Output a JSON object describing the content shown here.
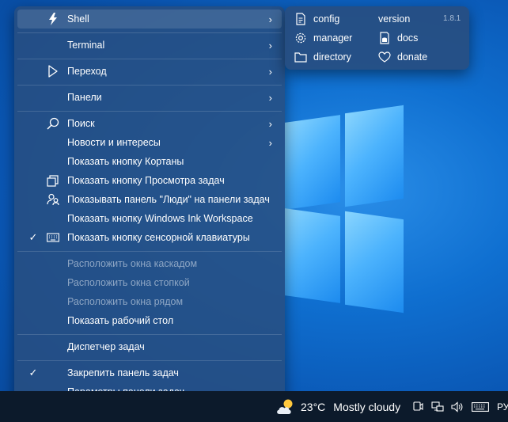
{
  "menu": {
    "items": [
      {
        "label": "Shell",
        "icon": "shell-icon",
        "arrow": true,
        "check": false,
        "disabled": false
      },
      {
        "label": "Terminal",
        "icon": "",
        "arrow": true,
        "check": false,
        "disabled": false
      },
      {
        "label": "Переход",
        "icon": "cursor-icon",
        "arrow": true,
        "check": false,
        "disabled": false
      },
      {
        "label": "Панели",
        "icon": "",
        "arrow": true,
        "check": false,
        "disabled": false
      },
      {
        "label": "Поиск",
        "icon": "search-icon",
        "arrow": true,
        "check": false,
        "disabled": false
      },
      {
        "label": "Новости и интересы",
        "icon": "",
        "arrow": true,
        "check": false,
        "disabled": false
      },
      {
        "label": "Показать кнопку Кортаны",
        "icon": "",
        "arrow": false,
        "check": false,
        "disabled": false
      },
      {
        "label": "Показать кнопку Просмотра задач",
        "icon": "task-view-icon",
        "arrow": false,
        "check": false,
        "disabled": false
      },
      {
        "label": "Показывать панель \"Люди\" на панели задач",
        "icon": "people-icon",
        "arrow": false,
        "check": false,
        "disabled": false
      },
      {
        "label": "Показать кнопку Windows Ink Workspace",
        "icon": "",
        "arrow": false,
        "check": false,
        "disabled": false
      },
      {
        "label": "Показать кнопку сенсорной клавиатуры",
        "icon": "keyboard-icon",
        "arrow": false,
        "check": true,
        "disabled": false
      },
      {
        "label": "Расположить окна каскадом",
        "icon": "",
        "arrow": false,
        "check": false,
        "disabled": true
      },
      {
        "label": "Расположить окна стопкой",
        "icon": "",
        "arrow": false,
        "check": false,
        "disabled": true
      },
      {
        "label": "Расположить окна рядом",
        "icon": "",
        "arrow": false,
        "check": false,
        "disabled": true
      },
      {
        "label": "Показать рабочий стол",
        "icon": "",
        "arrow": false,
        "check": false,
        "disabled": false
      },
      {
        "label": "Диспетчер задач",
        "icon": "",
        "arrow": false,
        "check": false,
        "disabled": false
      },
      {
        "label": "Закрепить панель задач",
        "icon": "",
        "arrow": false,
        "check": true,
        "disabled": false
      },
      {
        "label": "Параметры панели задач",
        "icon": "",
        "arrow": false,
        "check": false,
        "disabled": false
      }
    ]
  },
  "submenu": {
    "config": "config",
    "manager": "manager",
    "directory": "directory",
    "version": "version",
    "version_number": "1.8.1",
    "docs": "docs",
    "donate": "donate"
  },
  "taskbar": {
    "temperature": "23°C",
    "weather": "Mostly cloudy",
    "language": "РУ"
  },
  "colors": {
    "menu_bg": "#2b5286",
    "taskbar_bg": "#0c1a2b",
    "disabled_text": "#8ea6c4"
  }
}
